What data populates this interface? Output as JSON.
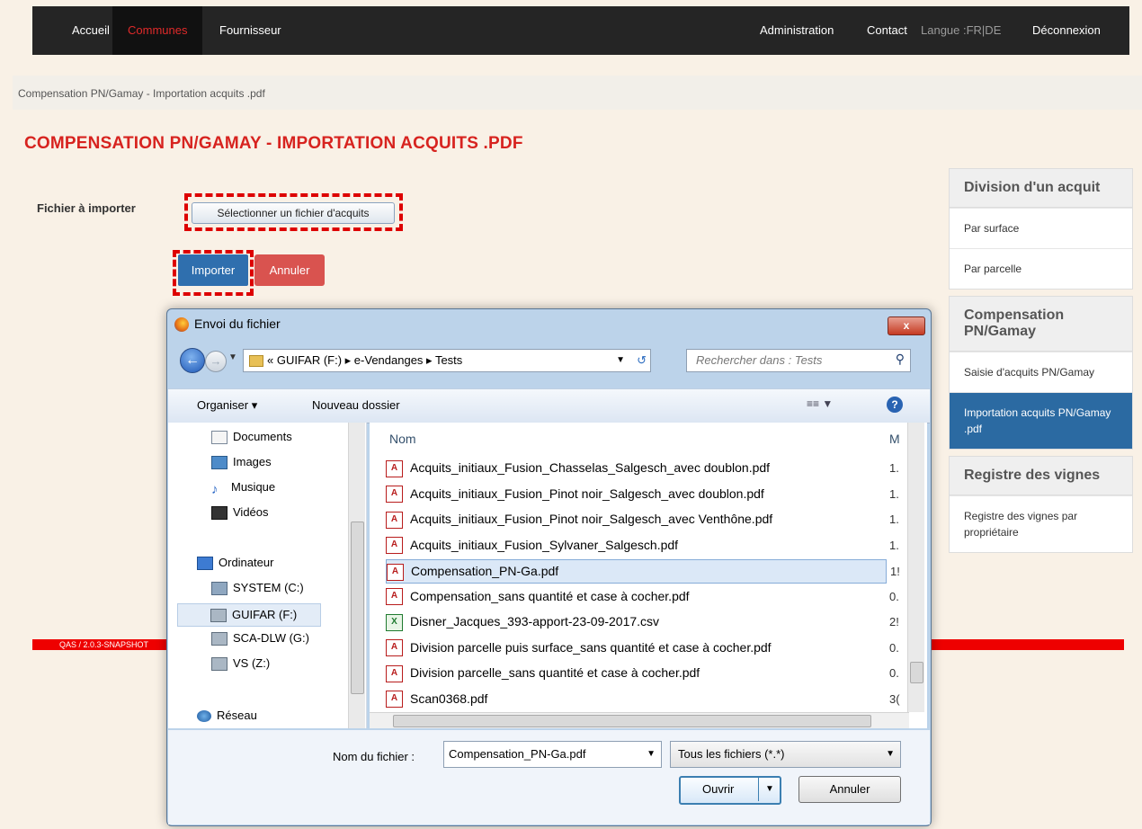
{
  "topnav": {
    "left": [
      "Accueil",
      "Communes",
      "Fournisseur"
    ],
    "administration": "Administration",
    "contact": "Contact",
    "langue": "Langue :FR|DE",
    "deconnexion": "Déconnexion"
  },
  "breadcrumb": "Compensation PN/Gamay - Importation acquits .pdf",
  "page_title": "COMPENSATION PN/GAMAY - IMPORTATION ACQUITS .PDF",
  "form": {
    "file_label": "Fichier à importer",
    "select_button": "Sélectionner un fichier d'acquits",
    "import_button": "Importer",
    "cancel_button": "Annuler"
  },
  "sidebar": {
    "groups": [
      {
        "title": "Division d'un acquit",
        "items": [
          "Par surface",
          "Par parcelle"
        ]
      },
      {
        "title": "Compensation PN/Gamay",
        "items": [
          "Saisie d'acquits PN/Gamay",
          "Importation acquits PN/Gamay .pdf"
        ]
      },
      {
        "title": "Registre des vignes",
        "items": [
          "Registre des vignes par propriétaire"
        ]
      }
    ]
  },
  "footer": {
    "version": "QAS / 2.0.3-SNAPSHOT"
  },
  "dialog": {
    "title": "Envoi du fichier",
    "close": "x",
    "path": "«  GUIFAR (F:)  ▸  e-Vendanges  ▸  Tests",
    "search_placeholder": "Rechercher dans : Tests",
    "organiser": "Organiser ▾",
    "nouveau_dossier": "Nouveau dossier",
    "tree": [
      "Documents",
      "Images",
      "Musique",
      "Vidéos",
      "Ordinateur",
      "SYSTEM (C:)",
      "GUIFAR (F:)",
      "SCA-DLW (G:)",
      "VS (Z:)",
      "Réseau"
    ],
    "column_name": "Nom",
    "column_modified": "M",
    "files": [
      {
        "name": "Acquits_initiaux_Fusion_Chasselas_Salgesch_avec doublon.pdf",
        "type": "pdf",
        "m": "1."
      },
      {
        "name": "Acquits_initiaux_Fusion_Pinot noir_Salgesch_avec doublon.pdf",
        "type": "pdf",
        "m": "1."
      },
      {
        "name": "Acquits_initiaux_Fusion_Pinot noir_Salgesch_avec Venthône.pdf",
        "type": "pdf",
        "m": "1."
      },
      {
        "name": "Acquits_initiaux_Fusion_Sylvaner_Salgesch.pdf",
        "type": "pdf",
        "m": "1."
      },
      {
        "name": "Compensation_PN-Ga.pdf",
        "type": "pdf",
        "m": "1!"
      },
      {
        "name": "Compensation_sans quantité et case à cocher.pdf",
        "type": "pdf",
        "m": "0."
      },
      {
        "name": "Disner_Jacques_393-apport-23-09-2017.csv",
        "type": "csv",
        "m": "2!"
      },
      {
        "name": "Division parcelle puis surface_sans quantité et case à cocher.pdf",
        "type": "pdf",
        "m": "0."
      },
      {
        "name": "Division parcelle_sans quantité et case à cocher.pdf",
        "type": "pdf",
        "m": "0."
      },
      {
        "name": "Scan0368.pdf",
        "type": "pdf",
        "m": "3("
      }
    ],
    "filename_label": "Nom du fichier :",
    "filename_value": "Compensation_PN-Ga.pdf",
    "filetype_value": "Tous les fichiers (*.*)",
    "open_button": "Ouvrir",
    "cancel_button": "Annuler"
  }
}
